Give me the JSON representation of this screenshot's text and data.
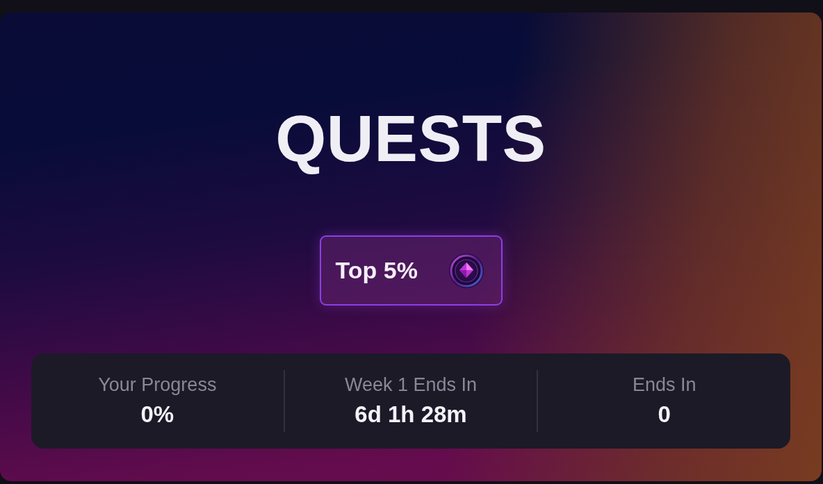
{
  "title": "QUESTS",
  "rank_badge": {
    "label": "Top 5%"
  },
  "stats": [
    {
      "label": "Your Progress",
      "value": "0%"
    },
    {
      "label": "Week 1 Ends In",
      "value": "6d 1h 28m"
    },
    {
      "label": "Ends In",
      "value": "0"
    }
  ]
}
